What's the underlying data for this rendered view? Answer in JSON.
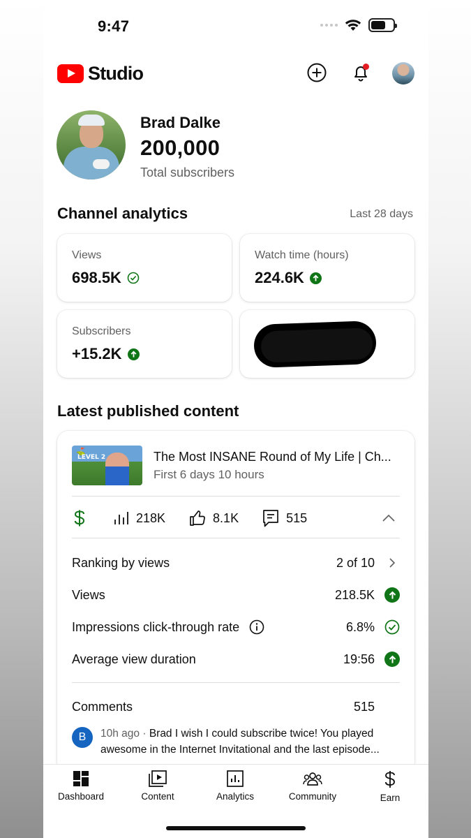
{
  "status_bar": {
    "time": "9:47"
  },
  "header": {
    "app_name": "Studio"
  },
  "profile": {
    "name": "Brad Dalke",
    "subscribers": "200,000",
    "subscribers_label": "Total subscribers"
  },
  "analytics": {
    "title": "Channel analytics",
    "period": "Last 28 days",
    "cards": [
      {
        "label": "Views",
        "value": "698.5K",
        "status": "check"
      },
      {
        "label": "Watch time (hours)",
        "value": "224.6K",
        "status": "up"
      },
      {
        "label": "Subscribers",
        "value": "+15.2K",
        "status": "up"
      }
    ]
  },
  "latest": {
    "title": "Latest published content",
    "video": {
      "thumbnail_text": "LEVEL 2",
      "title": "The Most INSANE Round of My Life | Ch...",
      "meta": "First 6 days 10 hours"
    },
    "stats": {
      "views": "218K",
      "likes": "8.1K",
      "comments": "515"
    },
    "rows": [
      {
        "label": "Ranking by views",
        "value": "2 of 10",
        "icon": "chevron-right-icon"
      },
      {
        "label": "Views",
        "value": "218.5K",
        "icon": "up-arrow-icon"
      },
      {
        "label": "Impressions click-through rate",
        "value": "6.8%",
        "icon": "check-circle-icon"
      },
      {
        "label": "Average view duration",
        "value": "19:56",
        "icon": "up-arrow-icon"
      }
    ],
    "comments_label": "Comments",
    "comments_count": "515",
    "comment": {
      "avatar_letter": "B",
      "time": "10h ago",
      "text": "Brad I wish I could subscribe twice! You played awesome in the Internet Invitational and the last episode..."
    }
  },
  "nav": {
    "items": [
      {
        "label": "Dashboard",
        "icon": "dashboard-icon"
      },
      {
        "label": "Content",
        "icon": "content-icon"
      },
      {
        "label": "Analytics",
        "icon": "analytics-icon"
      },
      {
        "label": "Community",
        "icon": "community-icon"
      },
      {
        "label": "Earn",
        "icon": "dollar-icon"
      }
    ]
  },
  "colors": {
    "brand_red": "#ff0000",
    "success_green": "#107516",
    "text_primary": "#0f0f0f",
    "text_secondary": "#606060"
  }
}
